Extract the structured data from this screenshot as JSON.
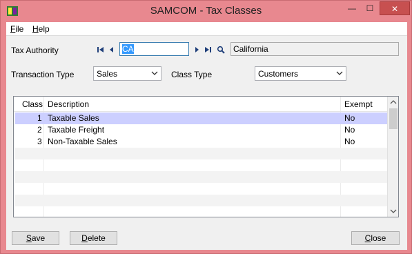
{
  "window": {
    "title": "SAMCOM - Tax Classes",
    "min_symbol": "—",
    "max_symbol": "☐",
    "close_symbol": "✕"
  },
  "menu": {
    "file_u": "F",
    "file_rest": "ile",
    "help_u": "H",
    "help_rest": "elp"
  },
  "form": {
    "tax_authority_label": "Tax Authority",
    "tax_authority_value": "CA",
    "tax_authority_name": "California",
    "transaction_type_label": "Transaction Type",
    "transaction_type_value": "Sales",
    "class_type_label": "Class Type",
    "class_type_value": "Customers"
  },
  "grid": {
    "headers": {
      "class": "Class",
      "description": "Description",
      "exempt": "Exempt"
    },
    "rows": [
      {
        "class": "1",
        "description": "Taxable Sales",
        "exempt": "No"
      },
      {
        "class": "2",
        "description": "Taxable Freight",
        "exempt": "No"
      },
      {
        "class": "3",
        "description": "Non-Taxable Sales",
        "exempt": "No"
      }
    ]
  },
  "buttons": {
    "save_u": "S",
    "save_rest": "ave",
    "delete_u": "D",
    "delete_rest": "elete",
    "close_u": "C",
    "close_rest": "lose"
  },
  "icons": {
    "app": "samcom-app-icon",
    "first": "first-record-icon",
    "prev": "previous-record-icon",
    "next": "next-record-icon",
    "last": "last-record-icon",
    "lookup": "magnifier-icon"
  }
}
